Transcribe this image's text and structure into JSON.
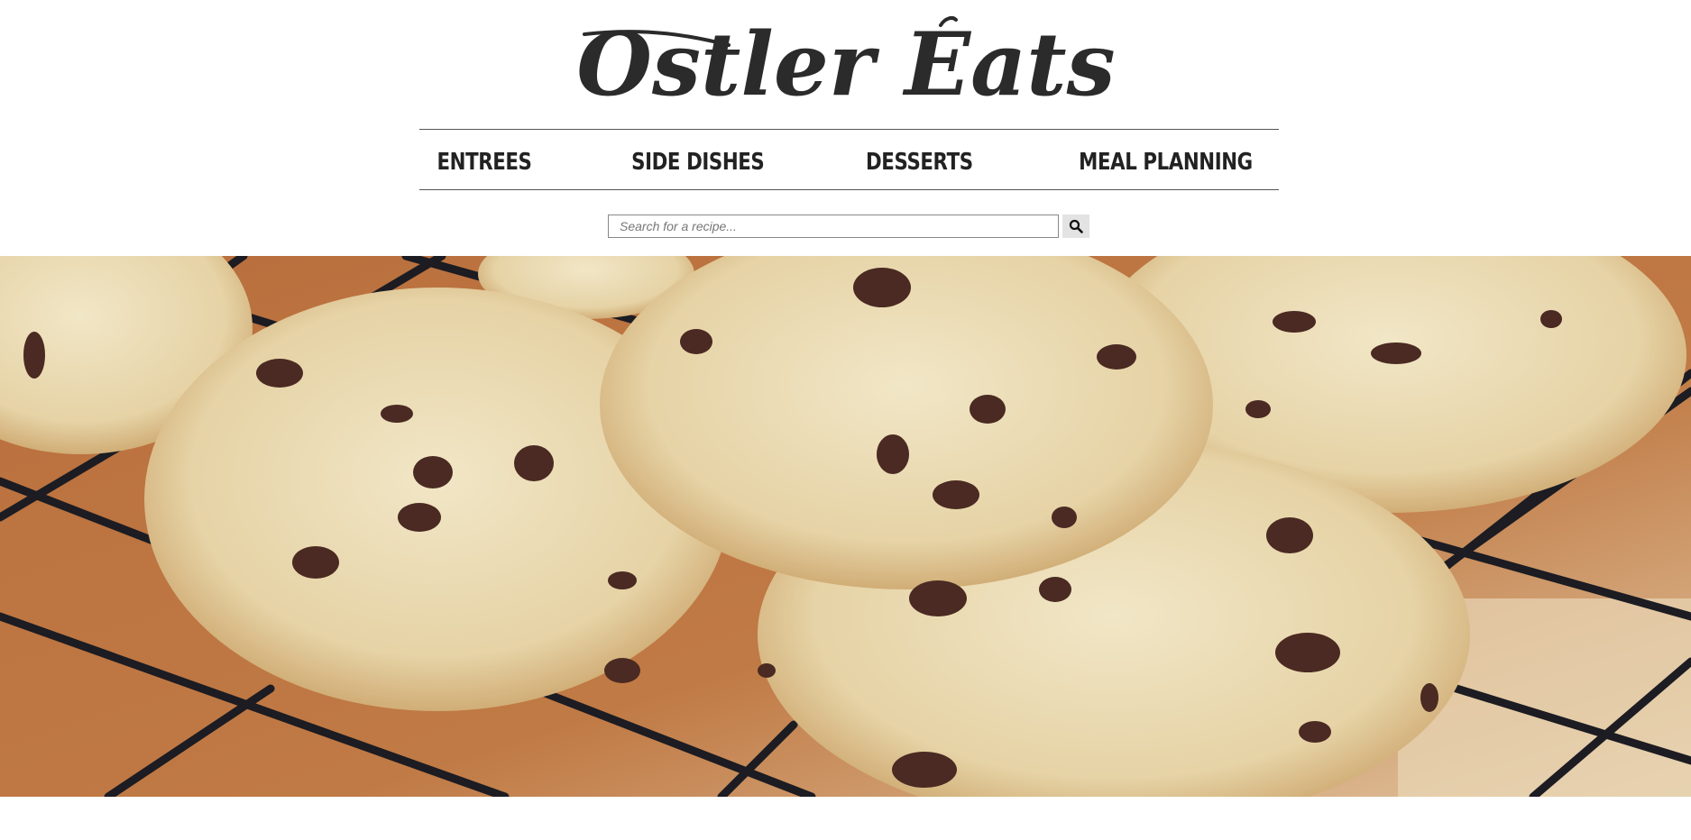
{
  "site": {
    "logo_text": "Ostler Eats"
  },
  "nav": {
    "items": [
      {
        "label": "ENTREES"
      },
      {
        "label": "SIDE DISHES"
      },
      {
        "label": "DESSERTS"
      },
      {
        "label": "MEAL PLANNING"
      }
    ]
  },
  "search": {
    "placeholder": "Search for a recipe...",
    "value": "",
    "button_icon": "search-icon"
  },
  "hero": {
    "subject": "chocolate-chip-cookies-image"
  },
  "colors": {
    "text": "#222222",
    "divider": "#555555",
    "search_button_bg": "#e3e3e3"
  }
}
